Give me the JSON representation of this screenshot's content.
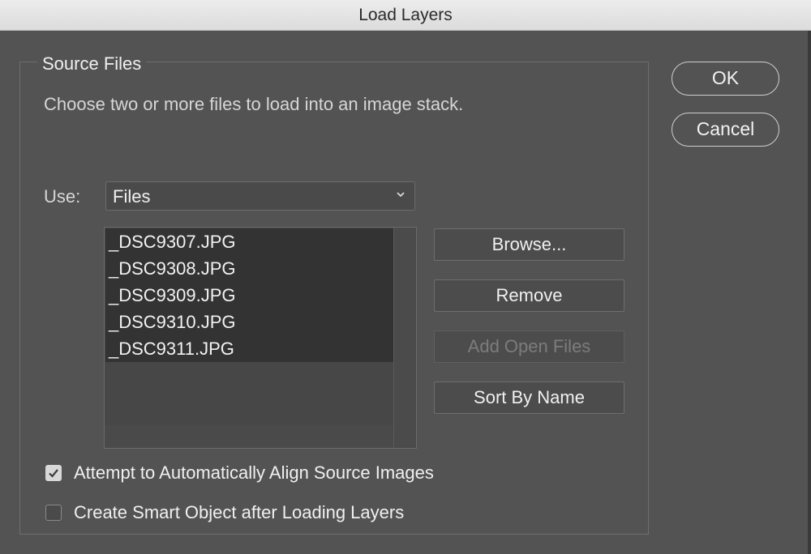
{
  "window": {
    "title": "Load Layers"
  },
  "source_files": {
    "legend": "Source Files",
    "description": "Choose two or more files to load into an image stack.",
    "use_label": "Use:",
    "use_value": "Files",
    "files": [
      "_DSC9307.JPG",
      "_DSC9308.JPG",
      "_DSC9309.JPG",
      "_DSC9310.JPG",
      "_DSC9311.JPG"
    ],
    "buttons": {
      "browse": "Browse...",
      "remove": "Remove",
      "add_open_files": "Add Open Files",
      "sort_by_name": "Sort By Name"
    }
  },
  "options": {
    "align": {
      "label": "Attempt to Automatically Align Source Images",
      "checked": true
    },
    "smart_object": {
      "label": "Create Smart Object after Loading Layers",
      "checked": false
    }
  },
  "actions": {
    "ok": "OK",
    "cancel": "Cancel"
  },
  "colors": {
    "dialog_bg": "#535353",
    "titlebar_bg": "#e4e4e4",
    "selection_bg": "#333333",
    "disabled_text": "#7c7c7c"
  }
}
